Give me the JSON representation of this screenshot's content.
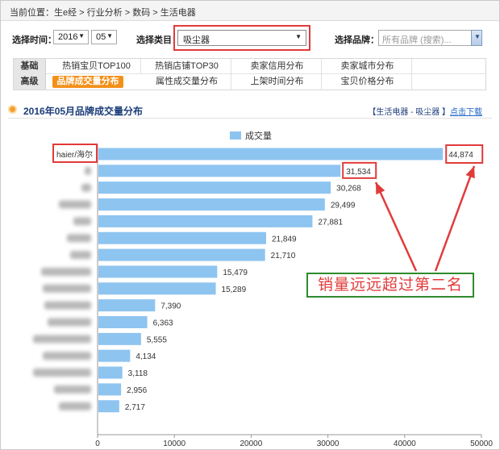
{
  "breadcrumb": "当前位置：生e经 > 行业分析 > 数码 > 生活电器",
  "filters": {
    "time_label": "选择时间：",
    "year": "2016",
    "month": "05",
    "category_label": "选择类目：",
    "category": "吸尘器",
    "brand_label": "选择品牌：",
    "brand_placeholder": "所有品牌 (搜索)..."
  },
  "tabs": {
    "row1_head": "基础",
    "row1": [
      "热销宝贝TOP100",
      "热销店铺TOP30",
      "卖家信用分布",
      "卖家城市分布"
    ],
    "row2_head": "高级",
    "row2": [
      "品牌成交量分布",
      "属性成交量分布",
      "上架时间分布",
      "宝贝价格分布"
    ],
    "active": "品牌成交量分布"
  },
  "section": {
    "title": "2016年05月品牌成交量分布",
    "context": "【生活电器 - 吸尘器 】",
    "download": "点击下载"
  },
  "chart_data": {
    "type": "bar",
    "orientation": "horizontal",
    "legend": [
      "成交量"
    ],
    "legend_position": "top",
    "bar_color": "#8ec4f0",
    "categories": [
      "haier/海尔",
      "",
      "",
      "",
      "",
      "",
      "",
      "",
      "",
      "",
      "",
      "",
      "",
      "",
      "",
      "",
      ""
    ],
    "series": [
      {
        "name": "成交量",
        "values": [
          44874,
          31534,
          30268,
          29499,
          27881,
          21849,
          21710,
          15479,
          15289,
          7390,
          6363,
          5555,
          4134,
          3118,
          2956,
          2717
        ]
      }
    ],
    "value_labels": [
      "44,874",
      "31,534",
      "30,268",
      "29,499",
      "27,881",
      "21,849",
      "21,710",
      "15,479",
      "15,289",
      "7,390",
      "6,363",
      "5,555",
      "4,134",
      "3,118",
      "2,956",
      "2,717"
    ],
    "xlim": [
      0,
      50000
    ],
    "xticks": [
      0,
      10000,
      20000,
      30000,
      40000,
      50000
    ],
    "highlighted": [
      "44,874",
      "31,534"
    ],
    "first_category": "haier/海尔"
  },
  "annotation": "销量远远超过第二名",
  "colors": {
    "highlight_red": "#e23a3a",
    "annotation_green": "#2e8b2e",
    "active_tab": "#f39019",
    "bar": "#8ec4f0"
  }
}
